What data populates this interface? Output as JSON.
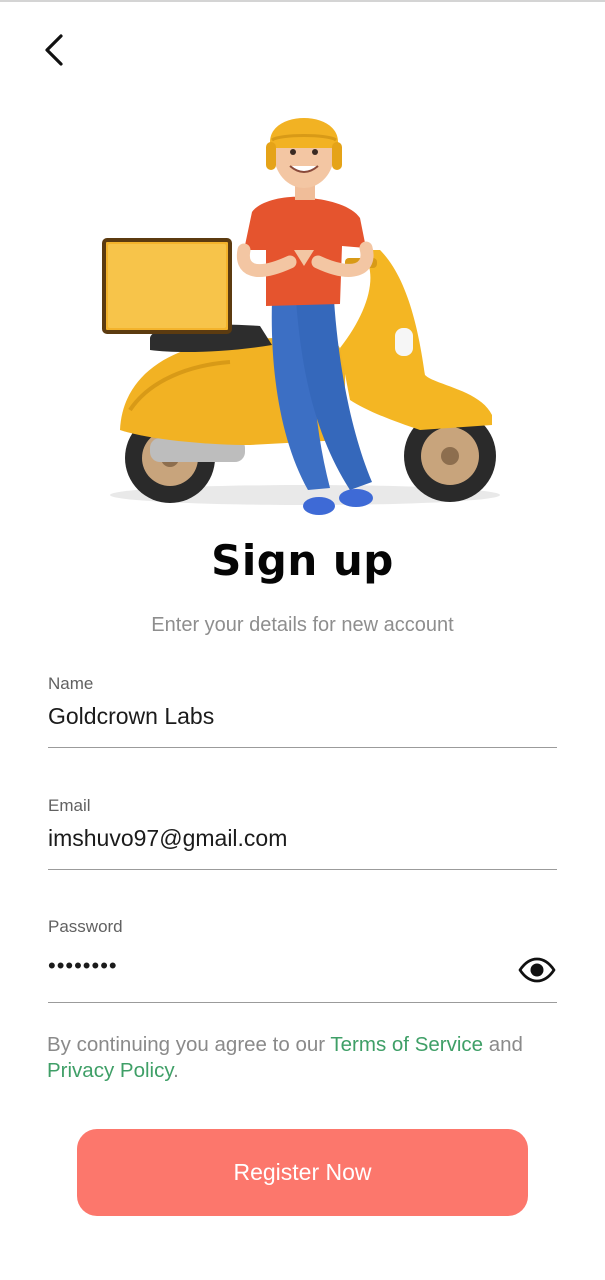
{
  "header": {
    "back_icon": "chevron-left-icon"
  },
  "hero": {
    "illustration": "delivery-rider-with-scooter"
  },
  "title": "Sign up",
  "subtitle": "Enter your details for new account",
  "form": {
    "name": {
      "label": "Name",
      "value": "Goldcrown Labs"
    },
    "email": {
      "label": "Email",
      "value": "imshuvo97@gmail.com"
    },
    "password": {
      "label": "Password",
      "value": "••••••••",
      "toggle_icon": "eye-icon"
    }
  },
  "terms": {
    "prefix": "By continuing you agree to our ",
    "terms_link": "Terms of Service",
    "middle": " and ",
    "privacy_link": "Privacy Policy",
    "suffix": "."
  },
  "register_button": "Register Now",
  "colors": {
    "accent": "#fc776c",
    "link": "#3f9f67",
    "scooter": "#f2b223",
    "shirt": "#e5542e",
    "jeans": "#3c6fc4"
  }
}
